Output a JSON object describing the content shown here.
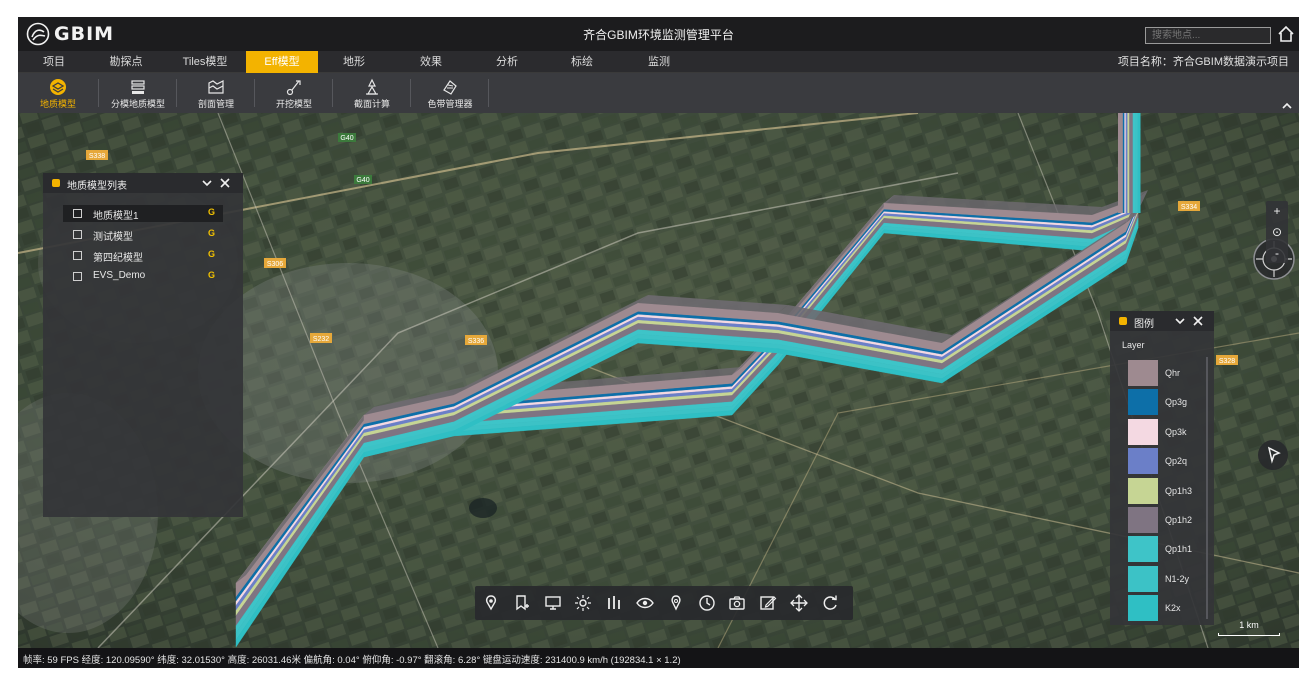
{
  "app": {
    "logo_text": "GBIM",
    "title": "齐合GBIM环境监测管理平台",
    "search_placeholder": "搜索地点..."
  },
  "menu": {
    "items": [
      {
        "label": "项目",
        "active": false
      },
      {
        "label": "勘探点",
        "active": false
      },
      {
        "label": "Tiles模型",
        "active": false
      },
      {
        "label": "Eff模型",
        "active": true
      },
      {
        "label": "地形",
        "active": false
      },
      {
        "label": "效果",
        "active": false
      },
      {
        "label": "分析",
        "active": false
      },
      {
        "label": "标绘",
        "active": false
      },
      {
        "label": "监测",
        "active": false
      }
    ],
    "project_name": "项目名称：齐合GBIM数据演示项目"
  },
  "toolbar": {
    "items": [
      {
        "label": "地质模型",
        "icon": "layers-icon",
        "active": true
      },
      {
        "label": "分模地质模型",
        "icon": "layer-split-icon",
        "active": false
      },
      {
        "label": "剖面管理",
        "icon": "section-icon",
        "active": false
      },
      {
        "label": "开挖模型",
        "icon": "excavate-icon",
        "active": false
      },
      {
        "label": "截面计算",
        "icon": "calculate-icon",
        "active": false
      },
      {
        "label": "色带管理器",
        "icon": "palette-icon",
        "active": false
      }
    ]
  },
  "model_panel": {
    "title": "地质模型列表",
    "items": [
      {
        "name": "地质模型1",
        "tag": "G",
        "selected": true
      },
      {
        "name": "测试模型",
        "tag": "G",
        "selected": false
      },
      {
        "name": "第四纪模型",
        "tag": "G",
        "selected": false
      },
      {
        "name": "EVS_Demo",
        "tag": "G",
        "selected": false
      }
    ]
  },
  "legend": {
    "title": "图例",
    "header": "Layer",
    "layers": [
      {
        "name": "Qhr",
        "color": "#9e8a90"
      },
      {
        "name": "Qp3g",
        "color": "#0d6fa8"
      },
      {
        "name": "Qp3k",
        "color": "#f4d9e2"
      },
      {
        "name": "Qp2q",
        "color": "#6b7fc8"
      },
      {
        "name": "Qp1h3",
        "color": "#c6d594"
      },
      {
        "name": "Qp1h2",
        "color": "#7f7482"
      },
      {
        "name": "Qp1h1",
        "color": "#3ec4c8"
      },
      {
        "name": "N1-2y",
        "color": "#3cc2c6"
      },
      {
        "name": "K2x",
        "color": "#2fbfc4"
      }
    ]
  },
  "dock": {
    "tools": [
      "pin-icon",
      "bookmark-add-icon",
      "screen-icon",
      "sun-icon",
      "bars-icon",
      "eye-icon",
      "location-icon",
      "clock-icon",
      "camera-icon",
      "edit-icon",
      "move-icon",
      "refresh-icon"
    ]
  },
  "map": {
    "scale": "1 km",
    "road_labels": [
      "S338",
      "G40",
      "G40",
      "S306",
      "S232",
      "S336",
      "S334",
      "S328"
    ],
    "zoom_in": "+",
    "zoom_reset": "⊙",
    "zoom_out": "-"
  },
  "status": {
    "text": "帧率: 59 FPS 经度: 120.09590° 纬度: 32.01530° 高度: 26031.46米 偏航角: 0.04° 俯仰角: -0.97° 翻滚角: 6.28° 键盘运动速度: 231400.9 km/h (192834.1 × 1.2)"
  },
  "colors": {
    "accent": "#f3b300",
    "title_bg": "#1c1c1e",
    "toolbar_bg": "#3a3b3f",
    "panel_bg": "#343538"
  }
}
